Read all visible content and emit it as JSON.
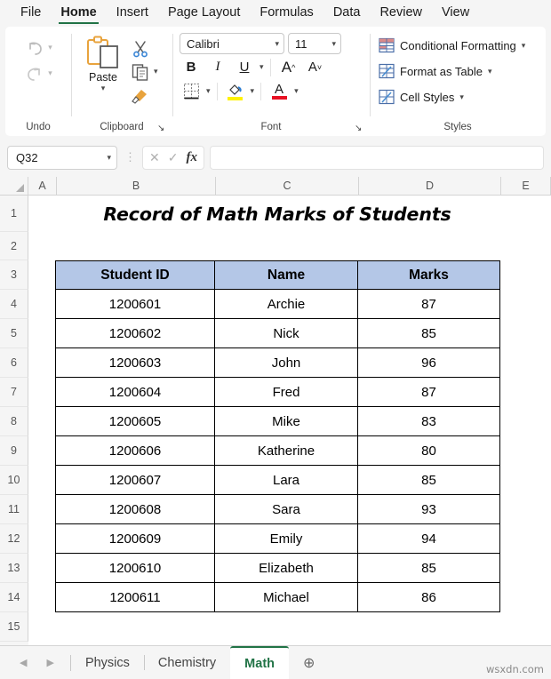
{
  "ribbon": {
    "tabs": [
      {
        "label": "File",
        "active": false
      },
      {
        "label": "Home",
        "active": true
      },
      {
        "label": "Insert",
        "active": false
      },
      {
        "label": "Page Layout",
        "active": false
      },
      {
        "label": "Formulas",
        "active": false
      },
      {
        "label": "Data",
        "active": false
      },
      {
        "label": "Review",
        "active": false
      },
      {
        "label": "View",
        "active": false
      }
    ],
    "groups": {
      "undo": {
        "label": "Undo",
        "undo_icon": "undo-arrow-icon",
        "redo_icon": "redo-arrow-icon"
      },
      "clipboard": {
        "label": "Clipboard",
        "paste_label": "Paste",
        "cut_icon": "scissors-icon",
        "copy_icon": "copy-icon",
        "format_painter_icon": "format-painter-icon",
        "launcher_icon": "dialog-launcher-icon"
      },
      "font": {
        "label": "Font",
        "font_name": "Calibri",
        "font_size": "11",
        "bold_label": "B",
        "italic_label": "I",
        "underline_label": "U",
        "grow_font_label": "A",
        "shrink_font_label": "A",
        "borders_icon": "borders-icon",
        "fill_color_icon": "fill-color-icon",
        "fill_color": "#FFF200",
        "font_color_icon": "font-color-icon",
        "font_color": "#E81123",
        "launcher_icon": "dialog-launcher-icon"
      },
      "styles": {
        "label": "Styles",
        "items": [
          {
            "label": "Conditional Formatting",
            "icon": "conditional-formatting-icon"
          },
          {
            "label": "Format as Table",
            "icon": "format-as-table-icon"
          },
          {
            "label": "Cell Styles",
            "icon": "cell-styles-icon"
          }
        ]
      }
    }
  },
  "formula_bar": {
    "name_box_value": "Q32",
    "cancel_label": "✕",
    "enter_label": "✓",
    "fx_label": "fx",
    "formula_value": ""
  },
  "sheet": {
    "columns": [
      "A",
      "B",
      "C",
      "D",
      "E"
    ],
    "rows": [
      "1",
      "2",
      "3",
      "4",
      "5",
      "6",
      "7",
      "8",
      "9",
      "10",
      "11",
      "12",
      "13",
      "14",
      "15"
    ],
    "title": "Record of Math Marks of Students",
    "header_fill": "#B4C7E7",
    "table": {
      "headers": [
        "Student ID",
        "Name",
        "Marks"
      ],
      "rows": [
        [
          "1200601",
          "Archie",
          "87"
        ],
        [
          "1200602",
          "Nick",
          "85"
        ],
        [
          "1200603",
          "John",
          "96"
        ],
        [
          "1200604",
          "Fred",
          "87"
        ],
        [
          "1200605",
          "Mike",
          "83"
        ],
        [
          "1200606",
          "Katherine",
          "80"
        ],
        [
          "1200607",
          "Lara",
          "85"
        ],
        [
          "1200608",
          "Sara",
          "93"
        ],
        [
          "1200609",
          "Emily",
          "94"
        ],
        [
          "1200610",
          "Elizabeth",
          "85"
        ],
        [
          "1200611",
          "Michael",
          "86"
        ]
      ]
    }
  },
  "tabbar": {
    "prev_label": "◀",
    "next_label": "▶",
    "sheets": [
      {
        "label": "Physics",
        "active": false
      },
      {
        "label": "Chemistry",
        "active": false
      },
      {
        "label": "Math",
        "active": true
      }
    ],
    "add_sheet_label": "⊕",
    "watermark": "wsxdn.com"
  }
}
